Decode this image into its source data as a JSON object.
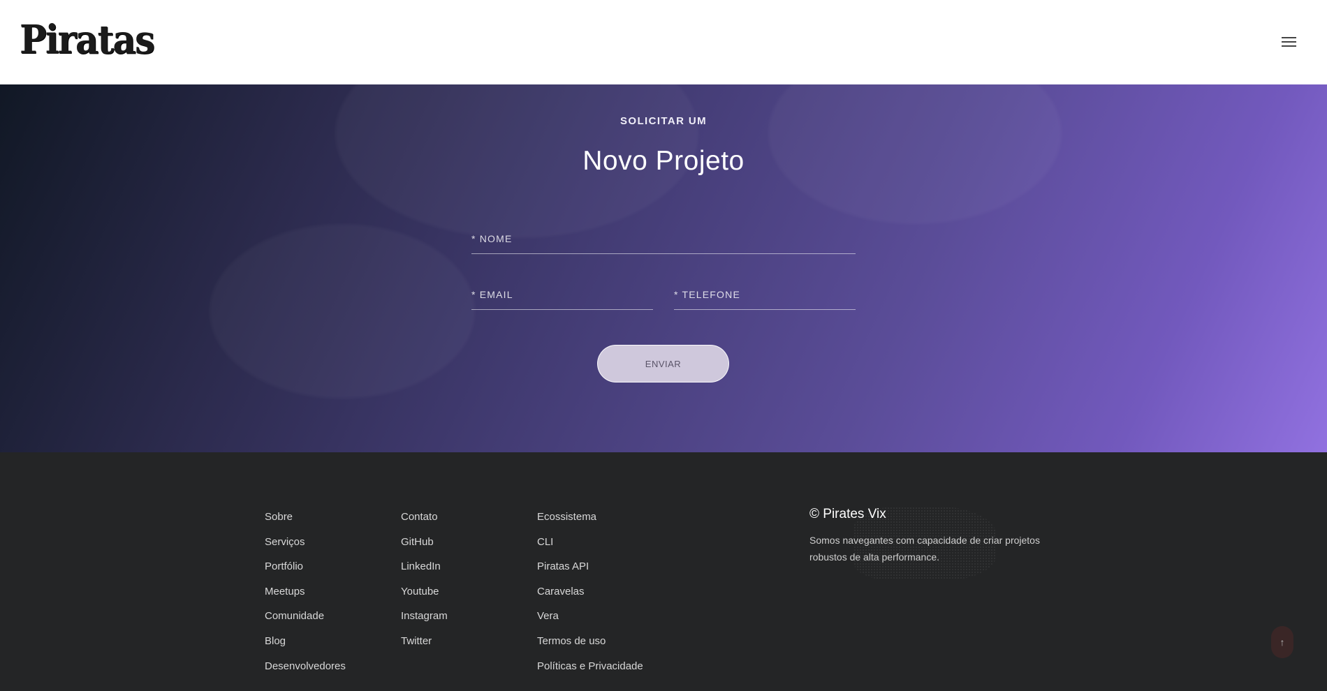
{
  "header": {
    "logo_text": "Piratas",
    "menu_icon": "hamburger-icon"
  },
  "hero": {
    "eyebrow": "SOLICITAR UM",
    "title": "Novo Projeto",
    "form": {
      "nome_placeholder": "* NOME",
      "email_placeholder": "* EMAIL",
      "telefone_placeholder": "* TELEFONE",
      "nome_value": "",
      "email_value": "",
      "telefone_value": "",
      "submit_label": "ENVIAR"
    }
  },
  "footer": {
    "col1": [
      "Sobre",
      "Serviços",
      "Portfólio",
      "Meetups",
      "Comunidade",
      "Blog",
      "Desenvolvedores"
    ],
    "col2": [
      "Contato",
      "GitHub",
      "LinkedIn",
      "Youtube",
      "Instagram",
      "Twitter"
    ],
    "col3": [
      "Ecossistema",
      "CLI",
      "Piratas API",
      "Caravelas",
      "Vera",
      "Termos de uso",
      "Políticas e Privacidade"
    ],
    "brand_title": "© Pirates Vix",
    "brand_desc": "Somos navegantes com capacidade de criar projetos robustos de alta performance.",
    "back_to_top_icon": "arrow-up-icon"
  },
  "colors": {
    "hero_start": "#111825",
    "hero_end": "#9171e0",
    "footer_bg": "#242526",
    "button_bg": "#cfc8dc"
  }
}
